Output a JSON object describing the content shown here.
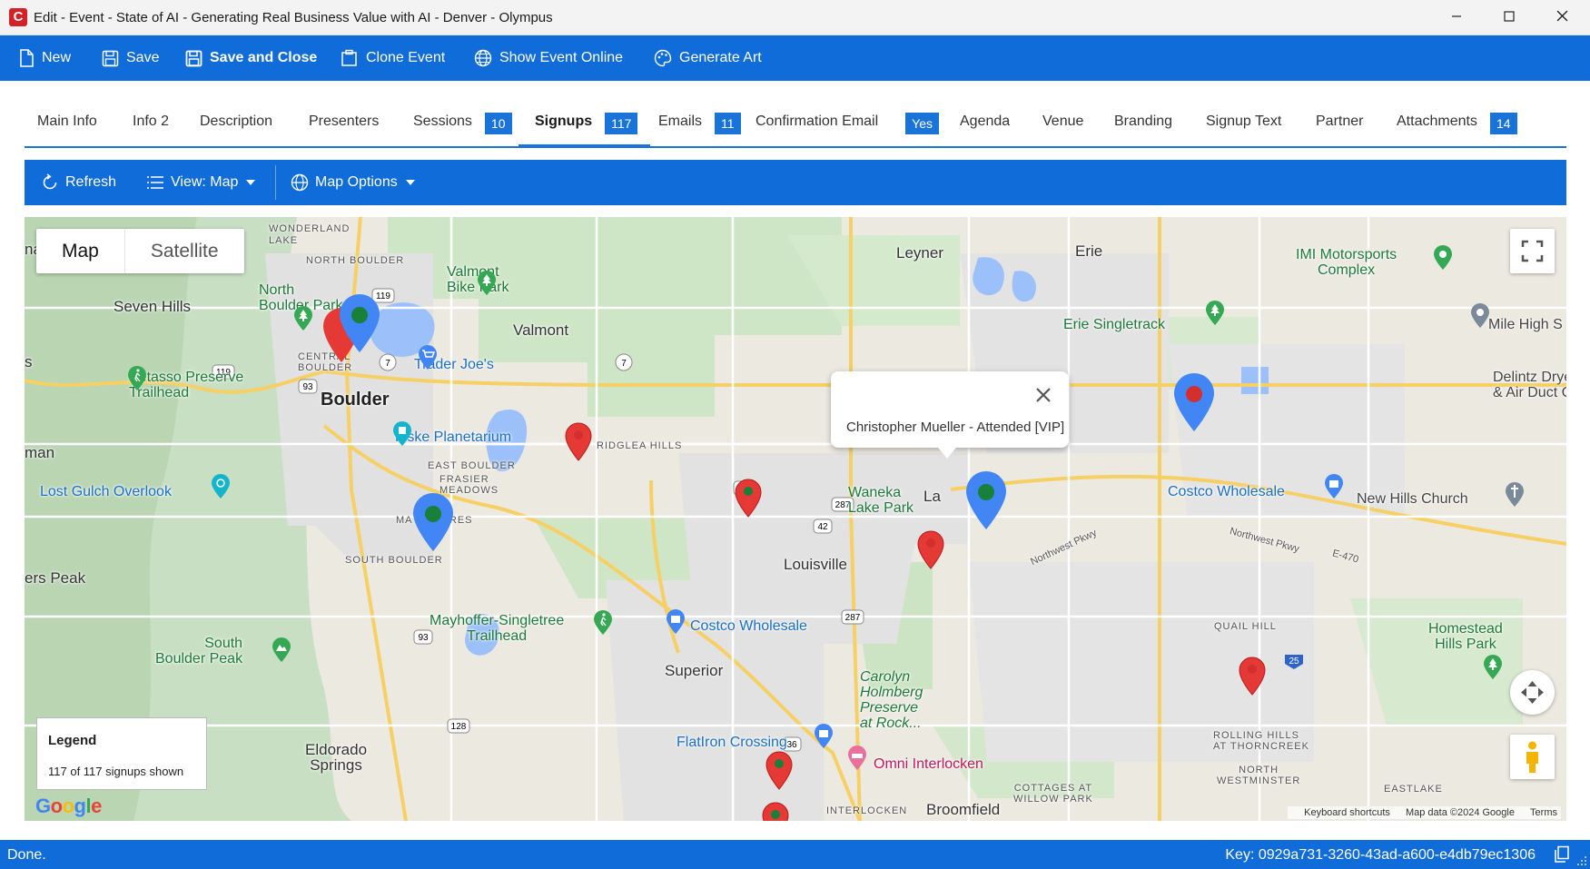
{
  "window": {
    "title": "Edit - Event - State of AI - Generating Real Business Value with AI - Denver - Olympus",
    "app_icon": "C"
  },
  "toolbar": {
    "new_label": "New",
    "save_label": "Save",
    "save_close_label": "Save and Close",
    "clone_label": "Clone Event",
    "show_online_label": "Show Event Online",
    "generate_art_label": "Generate Art"
  },
  "tabs": [
    {
      "label": "Main Info"
    },
    {
      "label": "Info 2"
    },
    {
      "label": "Description"
    },
    {
      "label": "Presenters"
    },
    {
      "label": "Sessions",
      "badge": "10"
    },
    {
      "label": "Signups",
      "badge": "117",
      "active": true
    },
    {
      "label": "Emails",
      "badge": "11"
    },
    {
      "label": "Confirmation Email",
      "badge": "Yes"
    },
    {
      "label": "Agenda"
    },
    {
      "label": "Venue"
    },
    {
      "label": "Branding"
    },
    {
      "label": "Signup Text"
    },
    {
      "label": "Partner"
    },
    {
      "label": "Attachments",
      "badge": "14"
    }
  ],
  "subtoolbar": {
    "refresh_label": "Refresh",
    "view_label": "View: Map",
    "map_options_label": "Map Options"
  },
  "map": {
    "type_map": "Map",
    "type_satellite": "Satellite",
    "popup_text": "Christopher Mueller - Attended [VIP]",
    "legend_title": "Legend",
    "legend_text": "117 of 117 signups shown",
    "google": "Google",
    "attribution": {
      "shortcuts": "Keyboard shortcuts",
      "data": "Map data ©2024 Google",
      "terms": "Terms"
    },
    "labels": {
      "wonderland_lake": "WONDERLAND\nLAKE",
      "north_boulder": "NORTH BOULDER",
      "valmont_bike_park": "Valmont\nBike Park",
      "north_boulder_park": "North\nBoulder Park",
      "seven_hills": "Seven Hills",
      "valmont": "Valmont",
      "leyner": "Leyner",
      "erie": "Erie",
      "imi_motorsports": "IMI Motorsports\nComplex",
      "mile_high": "Mile High S",
      "erie_singletrack": "Erie Singletrack",
      "trader_joes": "Trader Joe's",
      "central_boulder": "CENTRAL\nBOULDER",
      "betasso": "Betasso Preserve\nTrailhead",
      "boulder": "Boulder",
      "delintz": "Delintz Drye\n& Air Duct Cl",
      "fiske": "Fiske Planetarium",
      "ridglea_hills": "RIDGLEA HILLS",
      "east_boulder": "EAST BOULDER",
      "frasier_meadows": "FRASIER\nMEADOWS",
      "man": "man",
      "lost_gulch": "Lost Gulch Overlook",
      "waneka": "Waneka\nLake Park",
      "lafayette": "La",
      "costco1": "Costco Wholesale",
      "new_hills_church": "New Hills Church",
      "martin_acres": "MA      ACRES",
      "northwest_pkwy": "Northwest Pkwy",
      "northwest_pkwy2": "Northwest Pkwy",
      "e470": "E-470",
      "south_boulder": "SOUTH BOULDER",
      "louisville": "Louisville",
      "ers_peak": "ers Peak",
      "mayhoffer": "Mayhoffer-Singletree\nTrailhead",
      "costco2": "Costco Wholesale",
      "quail_hill": "QUAIL HILL",
      "homestead": "Homestead\nHills Park",
      "south_boulder_peak": "South\nBoulder Peak",
      "superior": "Superior",
      "carolyn": "Carolyn\nHolmberg\nPreserve\nat Rock...",
      "rolling_hills": "ROLLING HILLS\nAT THORNCREEK",
      "flatiron": "FlatIron Crossing",
      "omni": "Omni Interlocken",
      "eldorado": "Eldorado\nSprings",
      "north_westminster": "NORTH\nWESTMINSTER",
      "cottages": "COTTAGES AT\nWILLOW PARK",
      "eastlake": "EASTLAKE",
      "interlocken": "INTERLOCKEN",
      "broomfield": "Broomfield",
      "sevenhills_s": "s",
      "na": "na"
    },
    "route_shields": [
      "119",
      "119",
      "7",
      "7",
      "7",
      "93",
      "42",
      "42",
      "287",
      "287",
      "93",
      "128",
      "36",
      "25"
    ]
  },
  "status": {
    "text": "Done.",
    "key": "Key: 0929a731-3260-43ad-a600-e4db79ec1306"
  },
  "colors": {
    "brand_blue": "#0f6cd8",
    "tab_accent": "#1a73d8",
    "marker_red": "#e53935",
    "marker_blue": "#4285f4",
    "marker_green_dot": "#188038"
  }
}
